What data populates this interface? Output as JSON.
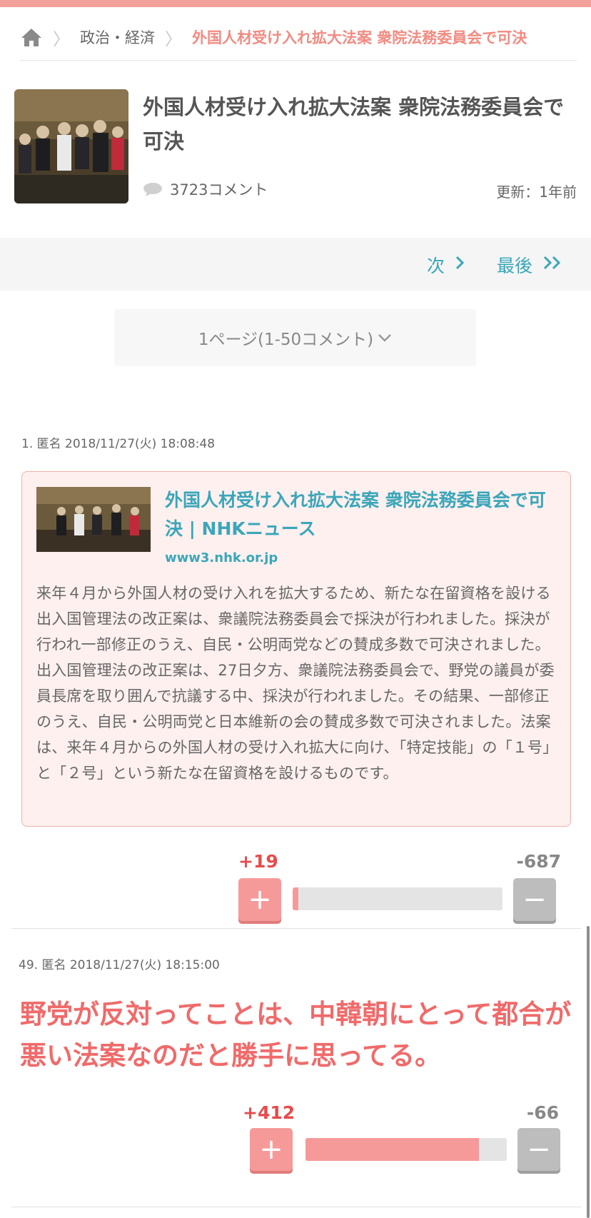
{
  "breadcrumb": {
    "home_icon": "home-icon",
    "category": "政治・経済",
    "current": "外国人材受け入れ拡大法案 衆院法務委員会で可決"
  },
  "article": {
    "title": "外国人材受け入れ拡大法案 衆院法務委員会で可決",
    "comment_count": "3723コメント",
    "updated": "更新：1年前"
  },
  "pager": {
    "next_label": "次",
    "last_label": "最後",
    "next_icon": "chevron-right-icon",
    "last_icon": "double-chevron-right-icon"
  },
  "page_select": {
    "label": "1ページ(1-50コメント)",
    "icon": "chevron-down-icon"
  },
  "comments": [
    {
      "meta": "1. 匿名 2018/11/27(火) 18:08:48",
      "quote": {
        "title": "外国人材受け入れ拡大法案 衆院法務委員会で可決 | NHKニュース",
        "domain": "www3.nhk.or.jp",
        "body": "来年４月から外国人材の受け入れを拡大するため、新たな在留資格を設ける出入国管理法の改正案は、衆議院法務委員会で採決が行われました。採決が行われ一部修正のうえ、自民・公明両党などの賛成多数で可決されました。出入国管理法の改正案は、27日夕方、衆議院法務委員会で、野党の議員が委員長席を取り囲んで抗議する中、採決が行われました。その結果、一部修正のうえ、自民・公明両党と日本維新の会の賛成多数で可決されました。法案は、来年４月からの外国人材の受け入れ拡大に向け、「特定技能」の「１号」と「２号」という新たな在留資格を設けるものです。"
      },
      "plus": "+19",
      "minus": "-687",
      "plus_ratio": 0.027
    },
    {
      "meta": "49. 匿名 2018/11/27(火) 18:15:00",
      "text": "野党が反対ってことは、中韓朝にとって都合が悪い法案なのだと勝手に思ってる。",
      "plus": "+412",
      "minus": "-66",
      "plus_ratio": 0.862
    }
  ],
  "colors": {
    "accent": "#f28b82",
    "link": "#3ba6ba",
    "plus": "#f59a99",
    "minus": "#bdbdbd"
  }
}
